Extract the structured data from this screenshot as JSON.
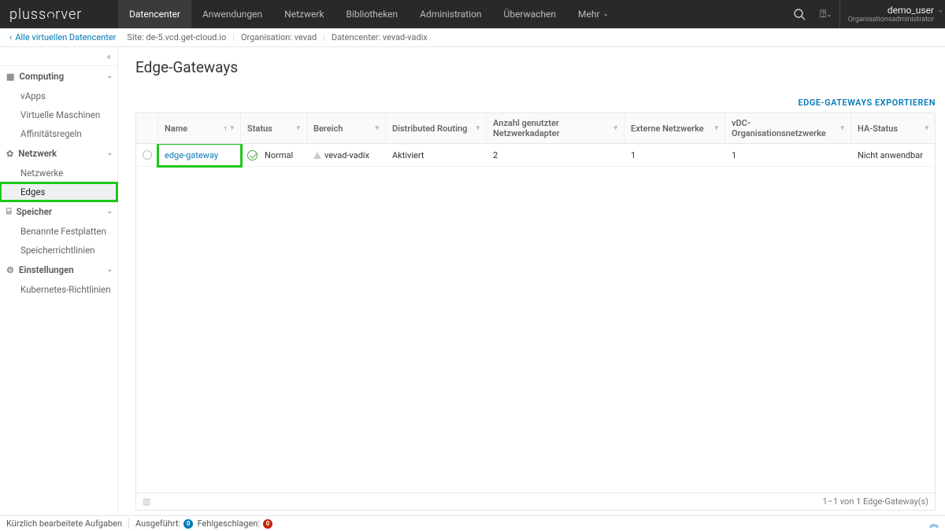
{
  "brand": "plusserver",
  "nav": {
    "items": [
      "Datencenter",
      "Anwendungen",
      "Netzwerk",
      "Bibliotheken",
      "Administration",
      "Überwachen"
    ],
    "more": "Mehr",
    "active": 0
  },
  "user": {
    "name": "demo_user",
    "role": "Organisationsadministrator"
  },
  "breadcrumb": {
    "back": "Alle virtuellen Datencenter",
    "site_label": "Site:",
    "site": "de-5.vcd.get-cloud.io",
    "org_label": "Organisation:",
    "org": "vevad",
    "dc_label": "Datencenter:",
    "dc": "vevad-vadix"
  },
  "sidebar": {
    "computing": {
      "label": "Computing",
      "items": [
        "vApps",
        "Virtuelle Maschinen",
        "Affinitätsregeln"
      ]
    },
    "network": {
      "label": "Netzwerk",
      "items": [
        "Netzwerke",
        "Edges"
      ],
      "active": 1
    },
    "storage": {
      "label": "Speicher",
      "items": [
        "Benannte Festplatten",
        "Speicherrichtlinien"
      ]
    },
    "settings": {
      "label": "Einstellungen",
      "items": [
        "Kubernetes-Richtlinien"
      ]
    }
  },
  "page": {
    "title": "Edge-Gateways",
    "export": "EDGE-GATEWAYS EXPORTIEREN"
  },
  "table": {
    "headers": {
      "name": "Name",
      "status": "Status",
      "scope": "Bereich",
      "drouting": "Distributed Routing",
      "adapters": "Anzahl genutzter Netzwerkadapter",
      "extnet": "Externe Netzwerke",
      "orgnet": "vDC-Organisationsnetzwerke",
      "ha": "HA-Status"
    },
    "rows": [
      {
        "name": "edge-gateway",
        "status": "Normal",
        "scope": "vevad-vadix",
        "drouting": "Aktiviert",
        "adapters": "2",
        "extnet": "1",
        "orgnet": "1",
        "ha": "Nicht anwendbar"
      }
    ],
    "footer": "1–1 von 1 Edge-Gateway(s)"
  },
  "statusbar": {
    "tasks": "Kürzlich bearbeitete Aufgaben",
    "running": "Ausgeführt:",
    "running_n": "0",
    "failed": "Fehlgeschlagen:",
    "failed_n": "0"
  }
}
